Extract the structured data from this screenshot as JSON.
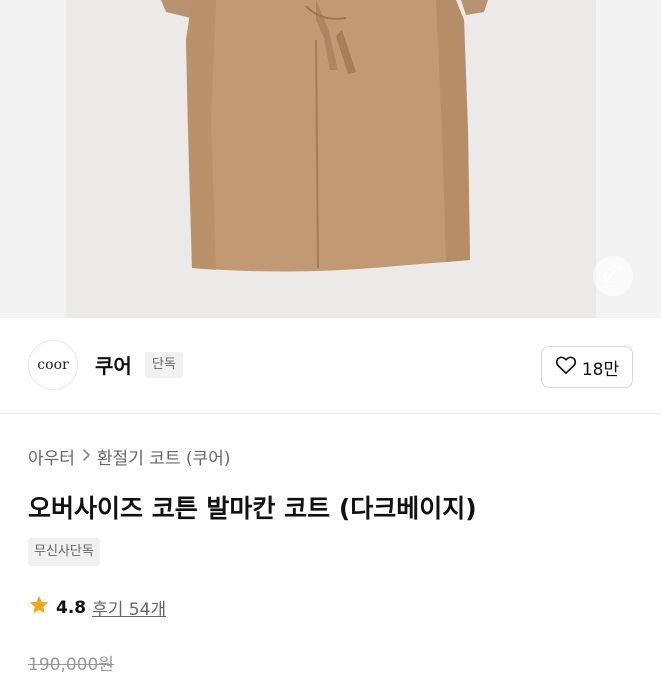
{
  "hero": {
    "image_alt": "dark beige oversized balmacaan coat",
    "expand_icon": "expand-arrows-icon"
  },
  "brand": {
    "logo_text": "coor",
    "name": "쿠어",
    "tag": "단독"
  },
  "like": {
    "icon": "heart-icon",
    "count": "18만"
  },
  "breadcrumb": {
    "category": "아우터",
    "separator_icon": "chevron-right-icon",
    "subcategory": "환절기 코트 (쿠어)"
  },
  "product": {
    "title": "오버사이즈 코튼 발마칸 코트 (다크베이지)",
    "badge": "무신사단독",
    "rating": "4.8",
    "rating_icon": "star-icon",
    "reviews": "후기 54개",
    "price": "190,000원"
  },
  "colors": {
    "coat": "#c19a74",
    "star": "#f5a623",
    "text_primary": "#111111",
    "text_secondary": "#666666"
  }
}
